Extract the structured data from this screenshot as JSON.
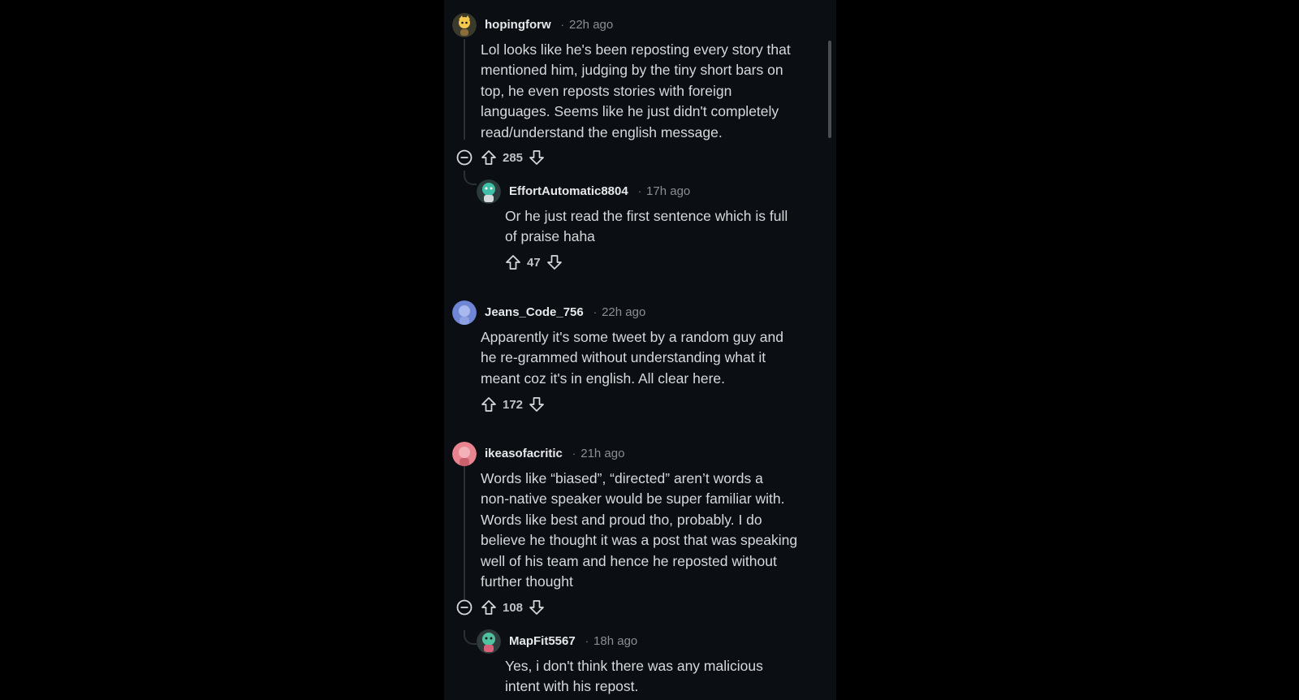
{
  "colors": {
    "background": "#000000",
    "panel": "#0b0e12",
    "text": "#d7dadc",
    "muted": "#8a8f95",
    "thread_line": "#2c3136"
  },
  "comments": [
    {
      "username": "hopingforw",
      "separator": "·",
      "time": "22h ago",
      "avatar_icon": "snoo-avatar-yellow",
      "lines": [
        "Lol looks like he's been reposting every story that",
        "mentioned him, judging by the tiny short bars on",
        "top, he even reposts stories with foreign",
        "languages. Seems like he just didn't completely",
        "read/understand the english message."
      ],
      "votes": "285",
      "reply": {
        "username": "EffortAutomatic8804",
        "separator": "·",
        "time": "17h ago",
        "avatar_icon": "snoo-avatar-teal",
        "lines": [
          "Or he just read the first sentence which is full",
          "of praise haha"
        ],
        "votes": "47"
      }
    },
    {
      "username": "Jeans_Code_756",
      "separator": "·",
      "time": "22h ago",
      "avatar_icon": "snoo-avatar-blue",
      "lines": [
        "Apparently it's some tweet by a random guy and",
        "he re-grammed without understanding what it",
        "meant coz it's in english. All clear here."
      ],
      "votes": "172"
    },
    {
      "username": "ikeasofacritic",
      "separator": "·",
      "time": "21h ago",
      "avatar_icon": "snoo-avatar-pink",
      "lines": [
        "Words like “biased”, “directed” aren’t words a",
        "non-native speaker would be super familiar with.",
        "Words like best and proud tho, probably. I do",
        "believe he thought it was a post that was speaking",
        "well of his team and hence he reposted without",
        "further thought"
      ],
      "votes": "108",
      "reply": {
        "username": "MapFit5567",
        "separator": "·",
        "time": "18h ago",
        "avatar_icon": "snoo-avatar-green",
        "lines": [
          "Yes, i don't think there was any malicious",
          "intent with his repost."
        ]
      }
    }
  ]
}
